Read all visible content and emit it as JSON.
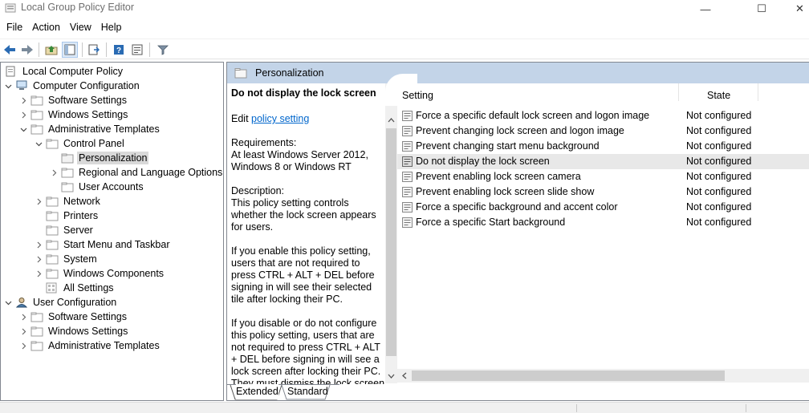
{
  "window": {
    "title": "Local Group Policy Editor",
    "minimize_glyph": "—",
    "maximize_glyph": "☐",
    "close_glyph": "✕"
  },
  "menu": {
    "items": [
      "File",
      "Action",
      "View",
      "Help"
    ]
  },
  "toolbar": {
    "buttons": [
      "back-icon",
      "forward-icon",
      "up-folder-icon",
      "show-hide-tree-icon",
      "export-list-icon",
      "help-icon",
      "properties-icon",
      "filter-icon"
    ]
  },
  "tree": {
    "root": "Local Computer Policy",
    "computer_configuration": "Computer Configuration",
    "cc_software_settings": "Software Settings",
    "cc_windows_settings": "Windows Settings",
    "cc_administrative_templates": "Administrative Templates",
    "control_panel": "Control Panel",
    "personalization": "Personalization",
    "regional": "Regional and Language Options",
    "user_accounts": "User Accounts",
    "network": "Network",
    "printers": "Printers",
    "server": "Server",
    "start_menu": "Start Menu and Taskbar",
    "system": "System",
    "windows_components": "Windows Components",
    "all_settings": "All Settings",
    "user_configuration": "User Configuration",
    "uc_software_settings": "Software Settings",
    "uc_windows_settings": "Windows Settings",
    "uc_administrative_templates": "Administrative Templates"
  },
  "header": {
    "title": "Personalization"
  },
  "description": {
    "title": "Do not display the lock screen",
    "edit_prefix": "Edit ",
    "edit_link": "policy setting",
    "requirements_label": "Requirements:",
    "requirements": "At least Windows Server 2012, Windows 8 or Windows RT",
    "description_label": "Description:",
    "description": "This policy setting controls whether the lock screen appears for users.",
    "enable_text": "If you enable this policy setting, users that are not required to press CTRL + ALT + DEL before signing in will see their selected tile after locking their PC.",
    "disable_text": "If you disable or do not configure this policy setting, users that are not required to press CTRL + ALT + DEL before signing in will see a lock screen after locking their PC. They must dismiss the lock screen"
  },
  "list": {
    "col_setting": "Setting",
    "col_state": "State",
    "rows": [
      {
        "name": "Force a specific default lock screen and logon image",
        "state": "Not configured"
      },
      {
        "name": "Prevent changing lock screen and logon image",
        "state": "Not configured"
      },
      {
        "name": "Prevent changing start menu background",
        "state": "Not configured"
      },
      {
        "name": "Do not display the lock screen",
        "state": "Not configured"
      },
      {
        "name": "Prevent enabling lock screen camera",
        "state": "Not configured"
      },
      {
        "name": "Prevent enabling lock screen slide show",
        "state": "Not configured"
      },
      {
        "name": "Force a specific background and accent color",
        "state": "Not configured"
      },
      {
        "name": "Force a specific Start background",
        "state": "Not configured"
      }
    ]
  },
  "tabs": {
    "extended": "Extended",
    "standard": "Standard"
  },
  "colors": {
    "header_bg": "#c3d4e8",
    "selection": "#d9d9d9",
    "link": "#0066cc",
    "row_highlight": "#e8e8e8"
  }
}
